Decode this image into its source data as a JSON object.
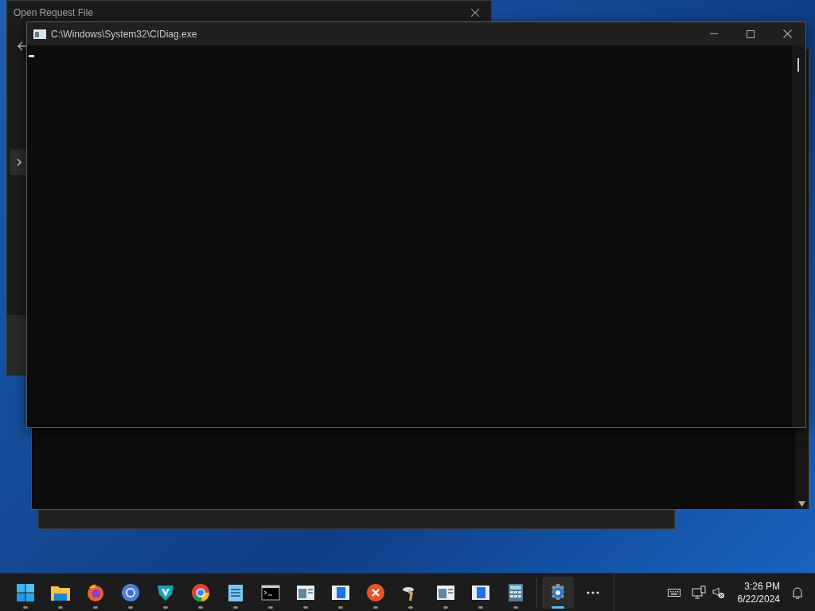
{
  "background_window": {
    "title": "Open Request File"
  },
  "console": {
    "title": "C:\\Windows\\System32\\CIDiag.exe"
  },
  "taskbar": {
    "apps": [
      {
        "kind": "start",
        "selected": false
      },
      {
        "kind": "folder",
        "selected": false
      },
      {
        "kind": "firefox",
        "selected": false
      },
      {
        "kind": "chromium",
        "selected": false
      },
      {
        "kind": "shield",
        "selected": false
      },
      {
        "kind": "chrome",
        "selected": false
      },
      {
        "kind": "notepad",
        "selected": false
      },
      {
        "kind": "terminal",
        "selected": false
      },
      {
        "kind": "window",
        "selected": false
      },
      {
        "kind": "bluewindow",
        "selected": false
      },
      {
        "kind": "redx",
        "selected": false
      },
      {
        "kind": "figure",
        "selected": false
      },
      {
        "kind": "window",
        "selected": false
      },
      {
        "kind": "bluewindow",
        "selected": false
      },
      {
        "kind": "calculator",
        "selected": false
      },
      {
        "kind": "gear",
        "selected": true
      }
    ],
    "tray": {
      "time": "3:26 PM",
      "date": "6/22/2024"
    }
  }
}
